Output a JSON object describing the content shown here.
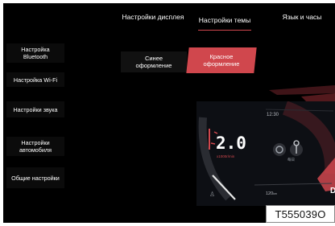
{
  "tabs": {
    "display": "Настройки дисплея",
    "theme": "Настройки темы",
    "language": "Язык и часы"
  },
  "sidebar": {
    "items": [
      {
        "label": "Настройка Bluetooth"
      },
      {
        "label": "Настройка Wi-Fi"
      },
      {
        "label": "Настройки звука"
      },
      {
        "label": "Настройки автомобиля"
      },
      {
        "label": "Общие настройки"
      }
    ]
  },
  "themes": {
    "blue": "Синее оформление",
    "red": "Красное оформление",
    "selected": "red"
  },
  "preview": {
    "time": "12:30",
    "speed": "2.0",
    "speed_unit": "x1000r/min",
    "range": "120",
    "range_unit": "km",
    "gear": "D",
    "icon_label": "每日"
  },
  "caption": "T555039O",
  "colors": {
    "accent_red": "#d0474d",
    "background": "#000000"
  }
}
